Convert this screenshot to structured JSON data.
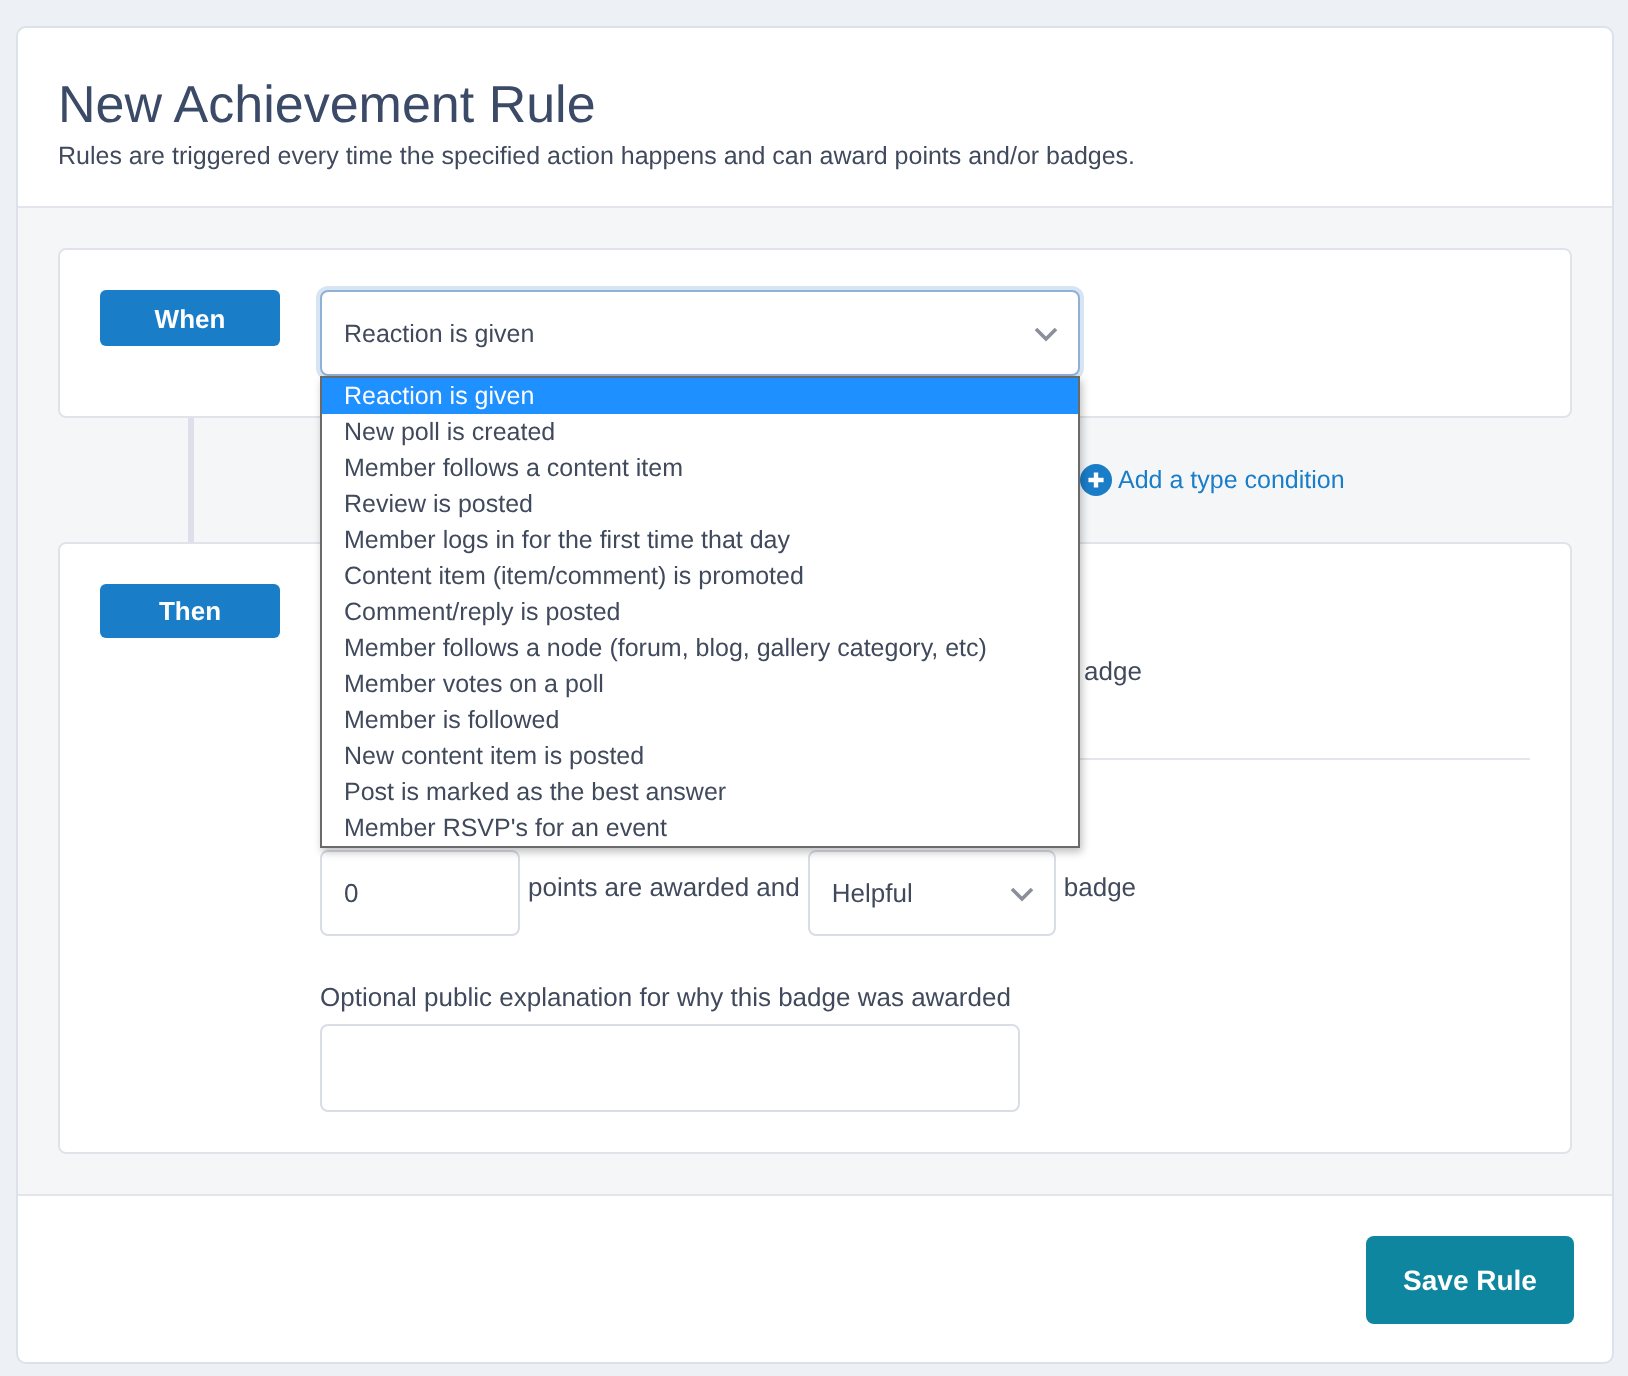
{
  "header": {
    "title": "New Achievement Rule",
    "description": "Rules are triggered every time the specified action happens and can award points and/or badges."
  },
  "when": {
    "label": "When",
    "select": {
      "value": "Reaction is given",
      "expanded": true,
      "options": [
        {
          "label": "Reaction is given",
          "selected": true
        },
        {
          "label": "New poll is created",
          "selected": false
        },
        {
          "label": "Member follows a content item",
          "selected": false
        },
        {
          "label": "Review is posted",
          "selected": false
        },
        {
          "label": "Member logs in for the first time that day",
          "selected": false
        },
        {
          "label": "Content item (item/comment) is promoted",
          "selected": false
        },
        {
          "label": "Comment/reply is posted",
          "selected": false
        },
        {
          "label": "Member follows a node (forum, blog, gallery category, etc)",
          "selected": false
        },
        {
          "label": "Member votes on a poll",
          "selected": false
        },
        {
          "label": "Member is followed",
          "selected": false
        },
        {
          "label": "New content item is posted",
          "selected": false
        },
        {
          "label": "Post is marked as the best answer",
          "selected": false
        },
        {
          "label": "Member RSVP's for an event",
          "selected": false
        }
      ]
    }
  },
  "add_condition": {
    "label": "Add a type condition"
  },
  "then": {
    "label": "Then",
    "first_rule": {
      "badge_text": "adge"
    },
    "second_rule": {
      "points": "0",
      "points_text": "points are awarded and",
      "badge": "Helpful",
      "badge_text": "badge",
      "explanation_label": "Optional public explanation for why this badge was awarded"
    }
  },
  "footer": {
    "save_button": "Save Rule"
  }
}
